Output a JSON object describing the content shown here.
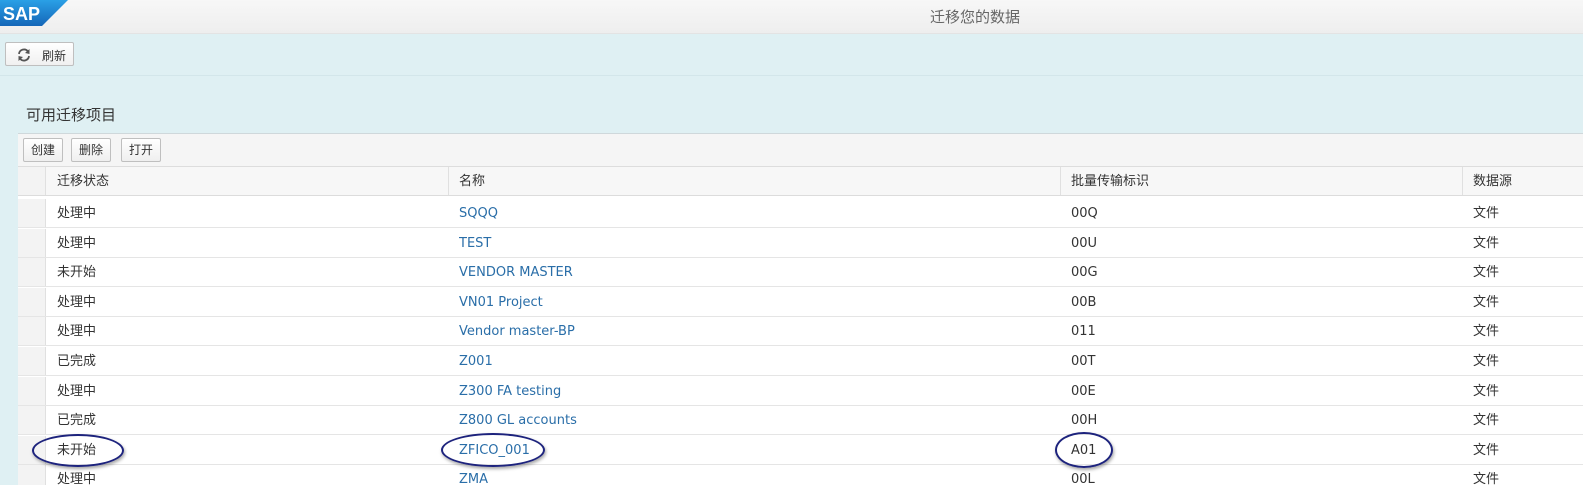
{
  "header": {
    "logo_text": "SAP",
    "title": "迁移您的数据"
  },
  "toolbar": {
    "refresh_label": "刷新",
    "refresh_icon": "refresh-icon"
  },
  "section": {
    "title": "可用迁移项目"
  },
  "table_toolbar": {
    "create_label": "创建",
    "delete_label": "删除",
    "open_label": "打开"
  },
  "table": {
    "columns": [
      "迁移状态",
      "名称",
      "批量传输标识",
      "数据源"
    ],
    "rows": [
      {
        "status": "处理中",
        "name": "SQQQ",
        "batch_id": "00Q",
        "source": "文件"
      },
      {
        "status": "处理中",
        "name": "TEST",
        "batch_id": "00U",
        "source": "文件"
      },
      {
        "status": "未开始",
        "name": "VENDOR MASTER",
        "batch_id": "00G",
        "source": "文件"
      },
      {
        "status": "处理中",
        "name": "VN01 Project",
        "batch_id": "00B",
        "source": "文件"
      },
      {
        "status": "处理中",
        "name": "Vendor master-BP",
        "batch_id": "011",
        "source": "文件"
      },
      {
        "status": "已完成",
        "name": "Z001",
        "batch_id": "00T",
        "source": "文件"
      },
      {
        "status": "处理中",
        "name": "Z300 FA testing",
        "batch_id": "00E",
        "source": "文件"
      },
      {
        "status": "已完成",
        "name": "Z800 GL accounts",
        "batch_id": "00H",
        "source": "文件"
      },
      {
        "status": "未开始",
        "name": "ZFICO_001",
        "batch_id": "A01",
        "source": "文件"
      },
      {
        "status": "处理中",
        "name": "ZMA",
        "batch_id": "00L",
        "source": "文件"
      }
    ]
  },
  "colors": {
    "link": "#2a6ea8",
    "background": "#dff0f3",
    "sap_blue": "#1a7fd1",
    "highlight": "#1d237d"
  }
}
